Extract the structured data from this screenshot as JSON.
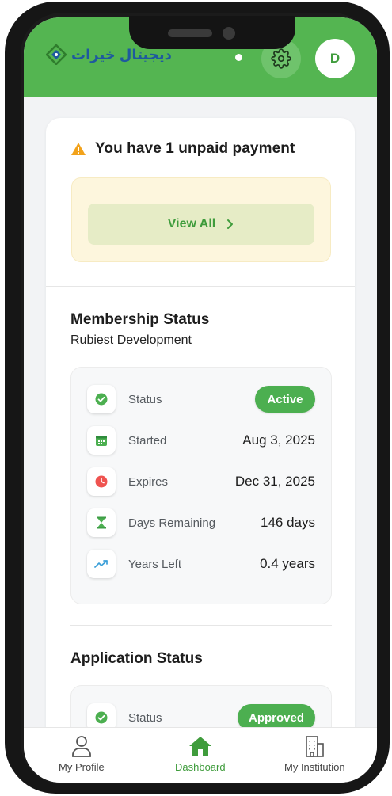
{
  "header": {
    "logo_text": "ديجيتال خيرات",
    "avatar_letter": "D",
    "accent_color": "#54b551",
    "icons": {
      "settings": "gear-icon",
      "logo": "logo-mark-icon"
    }
  },
  "alert": {
    "icon": "warning-icon",
    "title": "You have 1 unpaid payment",
    "view_all_label": "View All"
  },
  "membership": {
    "title": "Membership Status",
    "subtitle": "Rubiest Development",
    "rows": [
      {
        "icon": "check-circle-icon",
        "label": "Status",
        "value": "Active"
      },
      {
        "icon": "calendar-icon",
        "label": "Started",
        "value": "Aug 3, 2025"
      },
      {
        "icon": "clock-icon",
        "label": "Expires",
        "value": "Dec 31, 2025"
      },
      {
        "icon": "hourglass-icon",
        "label": "Days Remaining",
        "value": "146 days"
      },
      {
        "icon": "trending-up-icon",
        "label": "Years Left",
        "value": "0.4 years"
      }
    ]
  },
  "application": {
    "title": "Application Status",
    "rows": [
      {
        "icon": "check-circle-icon",
        "label": "Status",
        "value": "Approved"
      }
    ]
  },
  "nav": {
    "items": [
      {
        "icon": "user-icon",
        "label": "My Profile"
      },
      {
        "icon": "home-icon",
        "label": "Dashboard"
      },
      {
        "icon": "building-icon",
        "label": "My Institution"
      }
    ],
    "active_index": 1
  }
}
